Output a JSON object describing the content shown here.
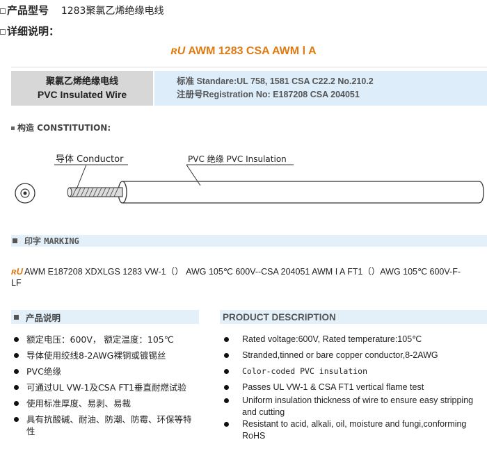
{
  "header": {
    "model_label": "产品型号",
    "model_value": "1283聚氯乙烯绝缘电线",
    "detail_label": "详细说明："
  },
  "title": {
    "logo": "ʀU",
    "text": "AWM 1283 CSA AWM Ⅰ A"
  },
  "standards": {
    "name_cn": "聚氯乙烯绝缘电线",
    "name_en": "PVC Insulated Wire",
    "standard_line": "标准 Standare:UL 758, 1581 CSA C22.2 No.210.2",
    "registration_line": "注册号Registration No: E187208 CSA 204051"
  },
  "construction": {
    "label": "构造 CONSTITUTION:",
    "conductor_label": "导体 Conductor",
    "insulation_label": "PVC 绝缘 PVC Insulation"
  },
  "marking": {
    "label_cn": "印字",
    "label_en": "MARKING",
    "logo": "ʀU",
    "text": "AWM E187208 XDXLGS  1283 VW-1（）  AWG 105℃ 600V--CSA 204051 AWM I A FT1（）AWG 105℃ 600V-F-LF"
  },
  "description_cn": {
    "title": "产品说明",
    "items": [
      "额定电压：600V，  额定温度：105℃",
      "导体使用绞线8-2AWG裸铜或镀锡丝",
      "PVC绝缘",
      "可通过UL VW-1及CSA FT1垂直耐燃试验",
      "使用标准厚度、易剥、易裁",
      "具有抗酸碱、耐油、防潮、防霉、环保等特性"
    ]
  },
  "description_en": {
    "title": "PRODUCT DESCRIPTION",
    "items": [
      "Rated voltage:600V, Rated temperature:105℃",
      "Stranded,tinned or bare  copper conductor,8-2AWG",
      "Color-coded PVC insulation",
      "Passes UL VW-1 & CSA FT1 vertical flame test",
      "Uniform insulation thickness of wire to ensure easy stripping and cutting",
      "Resistant to acid, alkali, oil, moisture and fungi,conforming RoHS"
    ]
  },
  "colors": {
    "accent_orange": "#e07a12",
    "grey_cell": "#d7d7d7",
    "blue_cell": "#ddeefa"
  }
}
